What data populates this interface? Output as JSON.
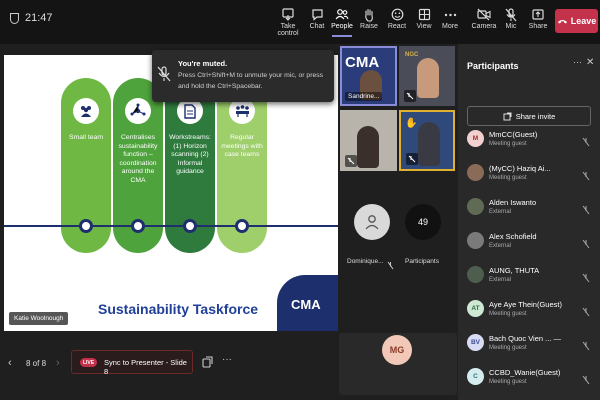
{
  "meeting": {
    "timer": "21:47"
  },
  "toolbar": [
    {
      "label": "Take control",
      "icon": "take-control-icon"
    },
    {
      "label": "Chat",
      "icon": "chat-icon"
    },
    {
      "label": "People",
      "icon": "people-icon"
    },
    {
      "label": "Raise",
      "icon": "raise-hand-icon"
    },
    {
      "label": "React",
      "icon": "react-icon"
    },
    {
      "label": "View",
      "icon": "view-icon"
    },
    {
      "label": "More",
      "icon": "more-icon"
    },
    {
      "label": "Camera",
      "icon": "camera-off-icon"
    },
    {
      "label": "Mic",
      "icon": "mic-off-icon"
    },
    {
      "label": "Share",
      "icon": "share-icon"
    }
  ],
  "leave_label": "Leave",
  "toast": {
    "title": "You're muted.",
    "body": "Press Ctrl+Shift+M to unmute your mic, or press and hold the Ctrl+Spacebar."
  },
  "slide": {
    "columns": [
      {
        "text": "Small team",
        "color": "#6fb843"
      },
      {
        "text": "Centralises sustainability function – coordination around the CMA",
        "color": "#4fa33c"
      },
      {
        "text": "Workstreams: (1) Horizon scanning (2) Informal guidance",
        "color": "#2f7b3d"
      },
      {
        "text": "Regular meetings with case teams",
        "color": "#9fcf6a"
      }
    ],
    "title": "Sustainability Taskforce",
    "presenter_label": "Katie Woolnough",
    "logo_text": "CMA"
  },
  "videos": {
    "tile1_name": "Sandrine...",
    "tile1_logo": "CMA",
    "tile2_logo": "NGC",
    "tile5_name": "Dominique...",
    "participants_count": "49",
    "participants_label": "Participants",
    "mg_initials": "MG"
  },
  "bottom": {
    "slide_counter": "8 of 8",
    "live_label": "LIVE",
    "sync_label": "Sync to Presenter - Slide 8"
  },
  "panel": {
    "title": "Participants",
    "share_label": "Share invite",
    "participants": [
      {
        "initials": "M",
        "name": "MmCC(Guest)",
        "role": "Meeting guest",
        "av_bg": "#f3d0d0",
        "av_fg": "#a02b2b"
      },
      {
        "initials": "",
        "name": "(MyCC) Haziq Ai...",
        "role": "Meeting guest",
        "av_bg": "#8a6a58",
        "av_fg": "#fff"
      },
      {
        "initials": "",
        "name": "Alden Iswanto",
        "role": "External",
        "av_bg": "#5f6b55",
        "av_fg": "#fff"
      },
      {
        "initials": "",
        "name": "Alex Schofield",
        "role": "External",
        "av_bg": "#7a7a7a",
        "av_fg": "#fff"
      },
      {
        "initials": "",
        "name": "AUNG, THUTA",
        "role": "External",
        "av_bg": "#4e5e4e",
        "av_fg": "#fff"
      },
      {
        "initials": "AT",
        "name": "Aye Aye Thein(Guest)",
        "role": "Meeting guest",
        "av_bg": "#cfe8d4",
        "av_fg": "#2e6b3c"
      },
      {
        "initials": "BV",
        "name": "Bach Quoc Vien ... —",
        "role": "Meeting guest",
        "av_bg": "#d8dcf2",
        "av_fg": "#3c4a96"
      },
      {
        "initials": "C",
        "name": "CCBD_Wanie(Guest)",
        "role": "Meeting guest",
        "av_bg": "#d4ecee",
        "av_fg": "#2b7480"
      }
    ]
  }
}
